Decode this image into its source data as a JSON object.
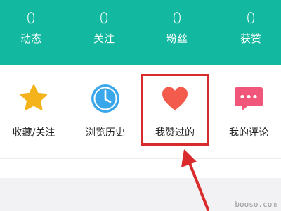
{
  "stats": [
    {
      "count": "0",
      "label": "动态"
    },
    {
      "count": "0",
      "label": "关注"
    },
    {
      "count": "0",
      "label": "粉丝"
    },
    {
      "count": "0",
      "label": "获赞"
    }
  ],
  "shortcuts": [
    {
      "label": "收藏/关注",
      "icon": "star-icon"
    },
    {
      "label": "浏览历史",
      "icon": "clock-icon"
    },
    {
      "label": "我赞过的",
      "icon": "heart-icon"
    },
    {
      "label": "我的评论",
      "icon": "comment-icon"
    }
  ],
  "colors": {
    "header_bg": "#12b9a0",
    "highlight": "#d92b2b",
    "star": "#f5b31b",
    "clock": "#3aa7ea",
    "heart": "#f35b4c",
    "comment": "#f0557a"
  },
  "watermark": "booso.com"
}
